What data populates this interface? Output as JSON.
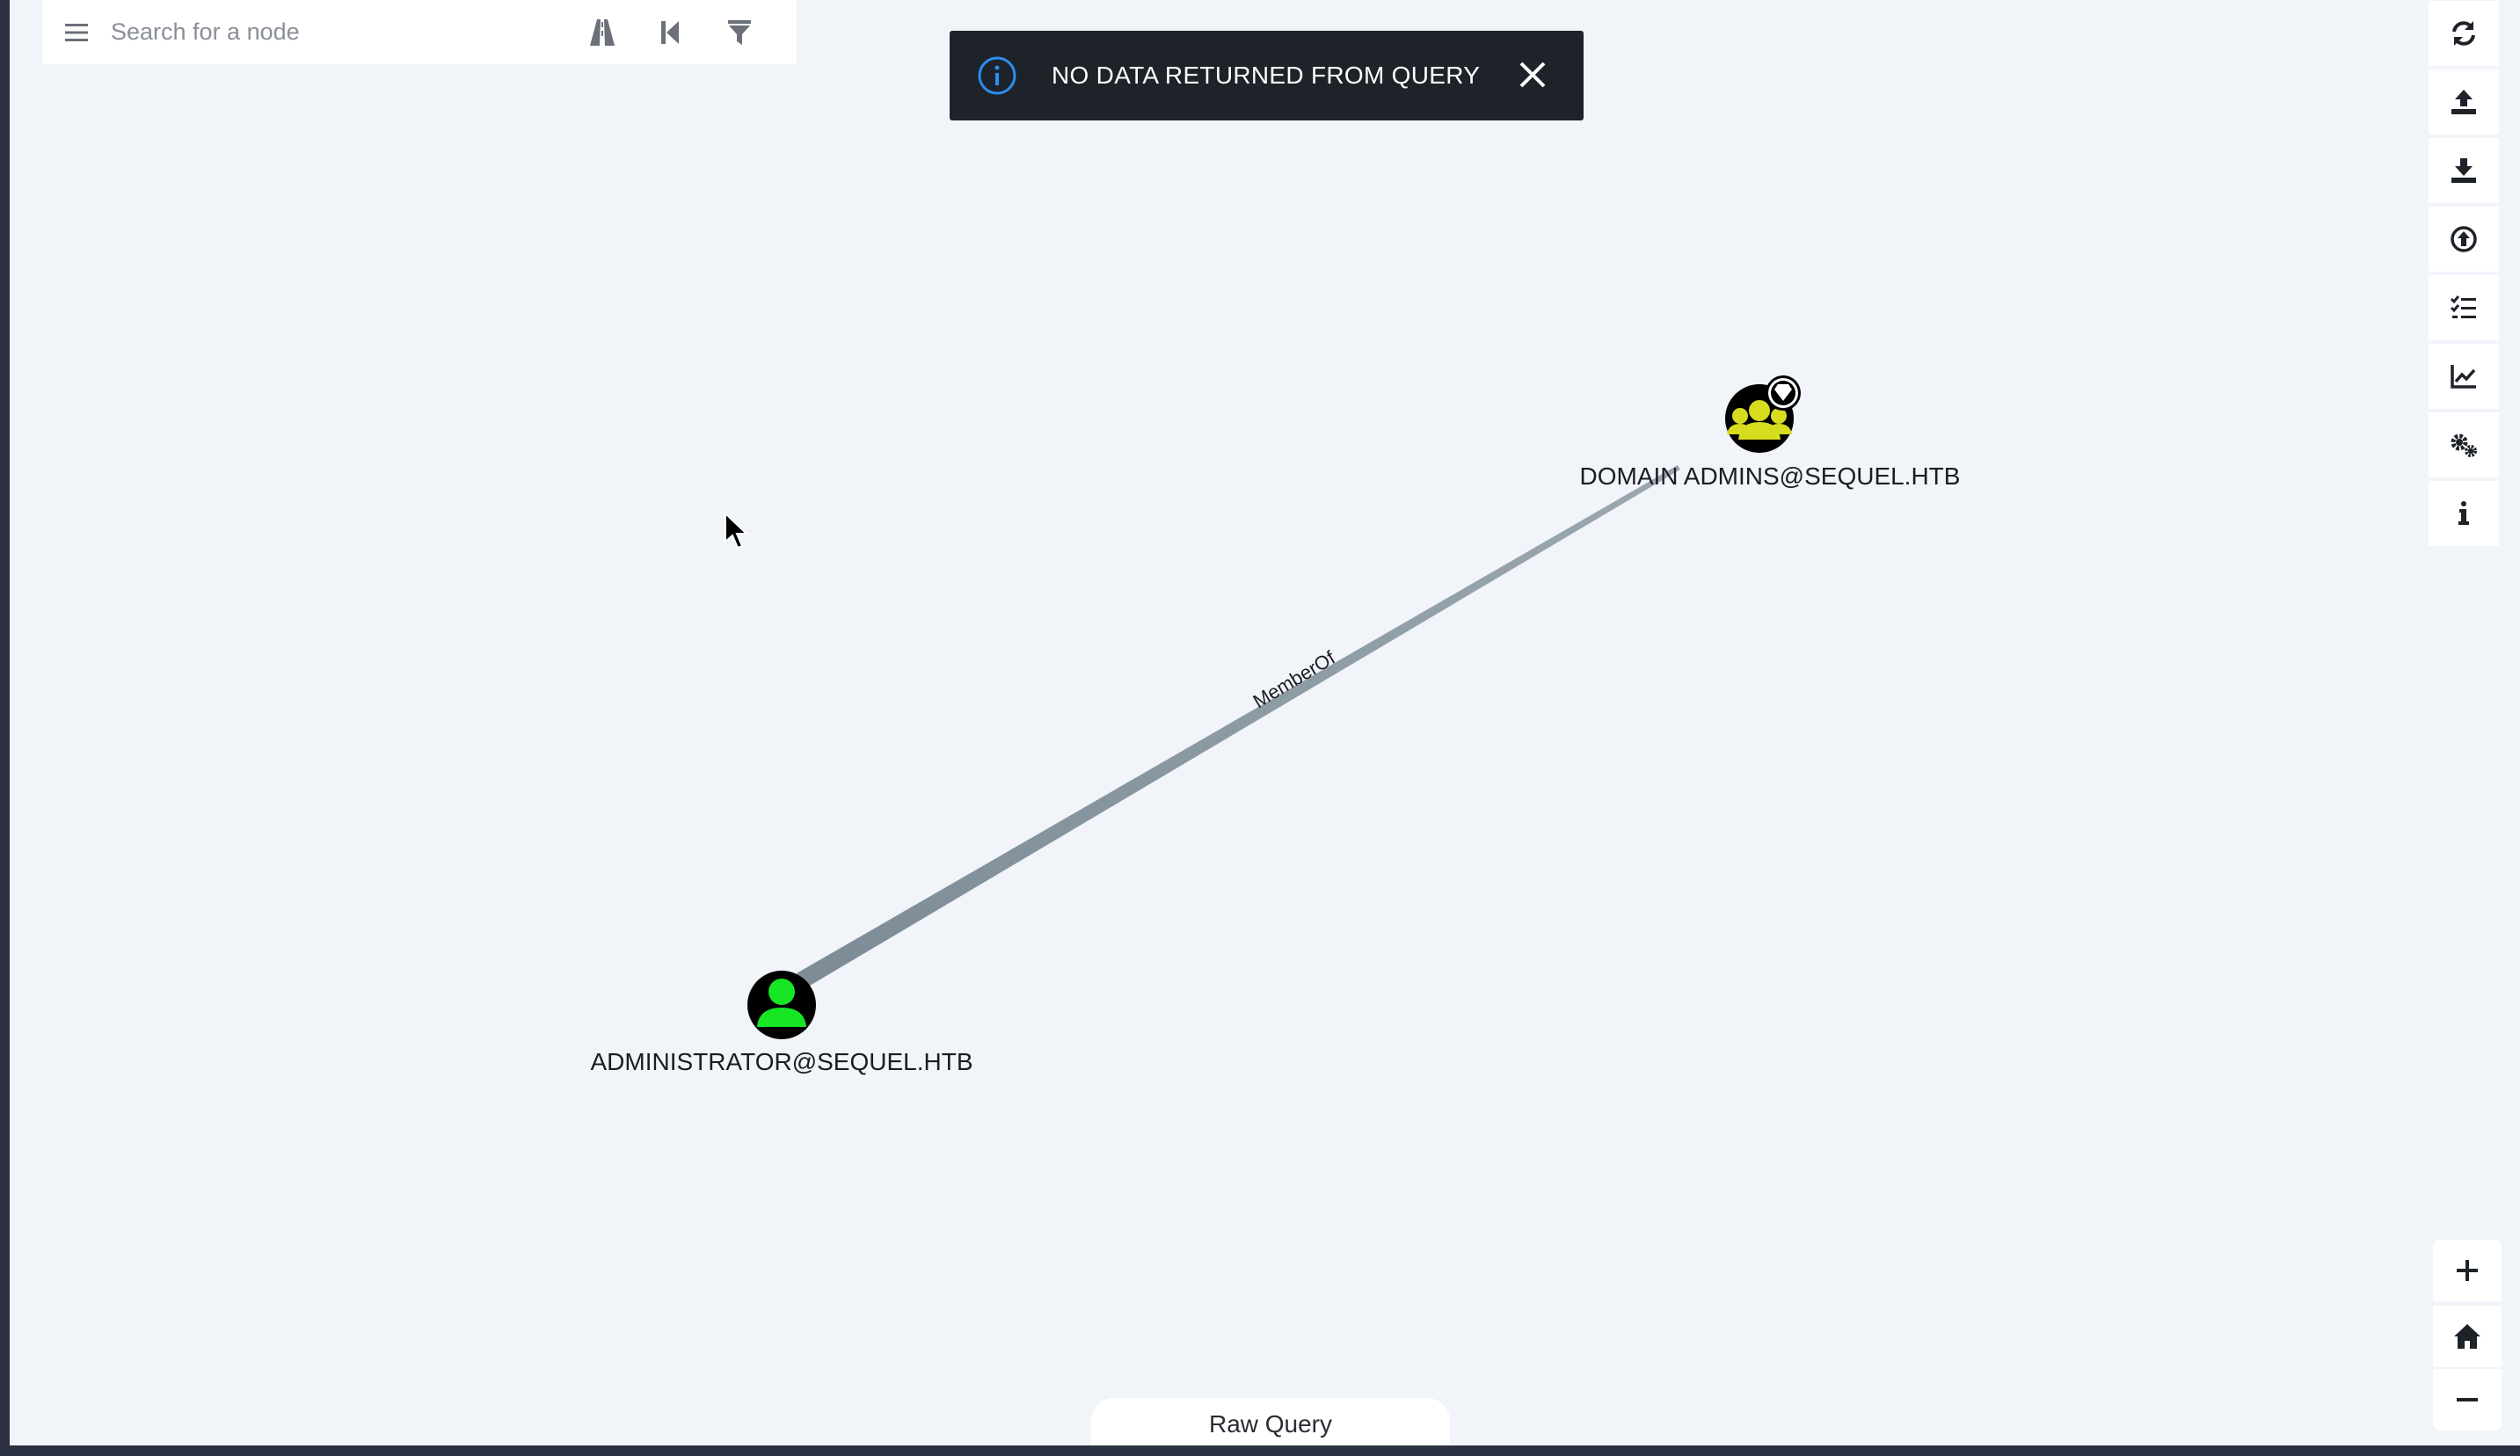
{
  "search": {
    "placeholder": "Search for a node"
  },
  "toast": {
    "message": "NO DATA RETURNED FROM QUERY"
  },
  "graph": {
    "nodes": [
      {
        "label": "DOMAIN ADMINS@SEQUEL.HTB",
        "type": "group",
        "color": "#d7dc1e",
        "highvalue": true
      },
      {
        "label": "ADMINISTRATOR@SEQUEL.HTB",
        "type": "user",
        "color": "#17e625"
      }
    ],
    "edge": {
      "label": "MemberOf",
      "color": "#7c8b96"
    }
  },
  "toolbar": {
    "right": [
      "refresh-icon",
      "upload-icon",
      "download-icon",
      "arrow-up-circle-icon",
      "tasks-icon",
      "chart-icon",
      "settings-icon",
      "info-icon"
    ],
    "zoom": [
      "zoom-in-icon",
      "home-icon",
      "zoom-out-icon"
    ]
  },
  "bottom": {
    "raw_query_label": "Raw Query"
  }
}
